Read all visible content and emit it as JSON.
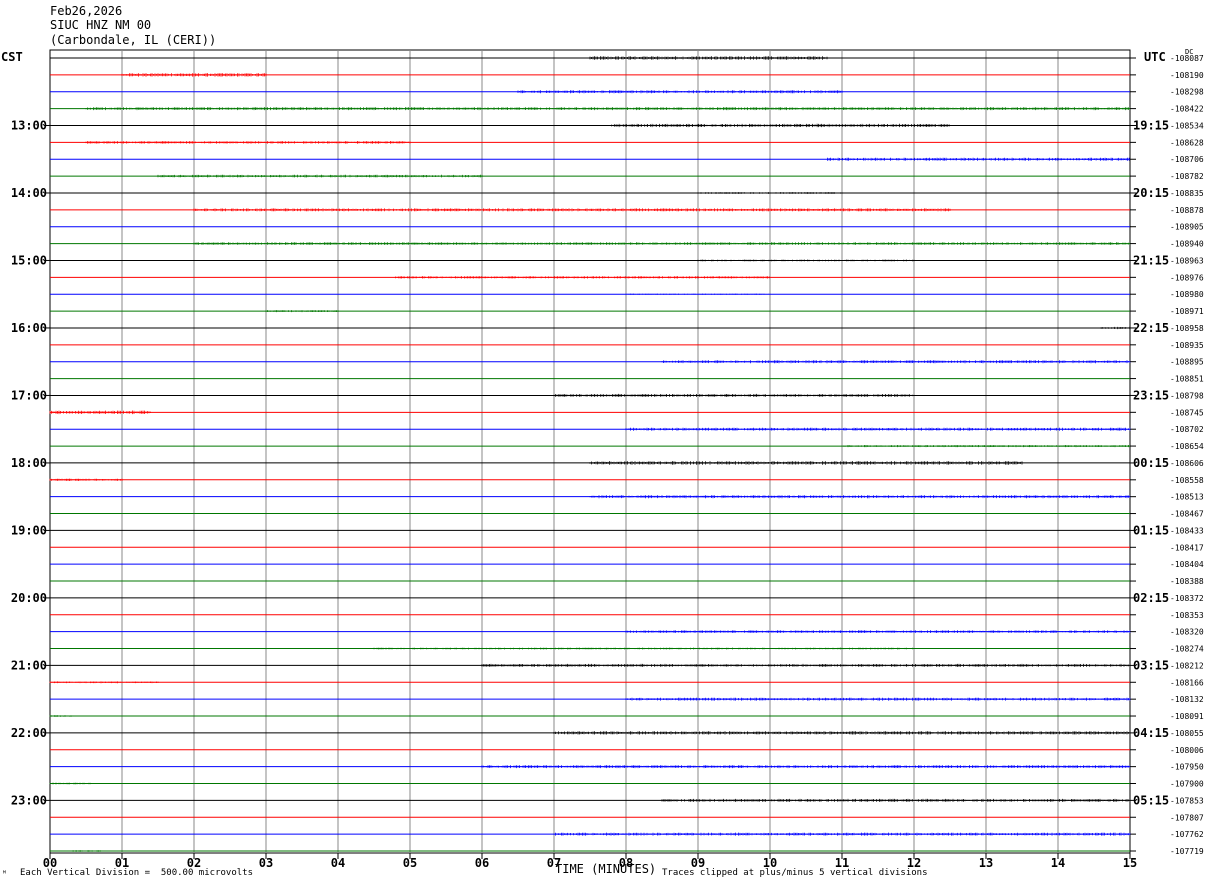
{
  "header": {
    "date": "Feb26,2026",
    "station": "SIUC HNZ NM 00",
    "location": "(Carbondale, IL (CERI))"
  },
  "labels": {
    "left_tz": "CST",
    "right_tz": "UTC",
    "dc_label": "DC",
    "xlabel": "TIME (MINUTES)",
    "scale_note": "Each Vertical Division =  500.00 microvolts",
    "clip_note": "Traces clipped at plus/minus 5 vertical divisions",
    "corner_mark": "ᴹ"
  },
  "colors": {
    "cycle": [
      "#000000",
      "#ff0000",
      "#0000ff",
      "#007700"
    ],
    "grid": "#888888"
  },
  "chart_data": {
    "type": "line",
    "title": "SIUC HNZ NM 00",
    "x_ticks": [
      "00",
      "01",
      "02",
      "03",
      "04",
      "05",
      "06",
      "07",
      "08",
      "09",
      "10",
      "11",
      "12",
      "13",
      "14",
      "15"
    ],
    "xlim": [
      0,
      15
    ],
    "hour_labels_left": [
      "13:00",
      "14:00",
      "15:00",
      "16:00",
      "17:00",
      "18:00",
      "19:00",
      "20:00",
      "21:00",
      "22:00",
      "23:00"
    ],
    "hour_labels_right": [
      "19:15",
      "20:15",
      "21:15",
      "22:15",
      "23:15",
      "00:15",
      "01:15",
      "02:15",
      "03:15",
      "04:15",
      "05:15"
    ],
    "dc_offsets": [
      "-108087",
      "-108190",
      "-108298",
      "-108422",
      "-108534",
      "-108628",
      "-108706",
      "-108782",
      "-108835",
      "-108878",
      "-108905",
      "-108940",
      "-108963",
      "-108976",
      "-108980",
      "-108971",
      "-108958",
      "-108935",
      "-108895",
      "-108851",
      "-108798",
      "-108745",
      "-108702",
      "-108654",
      "-108606",
      "-108558",
      "-108513",
      "-108467",
      "-108433",
      "-108417",
      "-108404",
      "-108388",
      "-108372",
      "-108353",
      "-108320",
      "-108274",
      "-108212",
      "-108166",
      "-108132",
      "-108091",
      "-108055",
      "-108006",
      "-107950",
      "-107900",
      "-107853",
      "-107807",
      "-107762",
      "-107719"
    ],
    "noise": [
      [
        7.5,
        10.8,
        1.2
      ],
      [
        1.0,
        3.0,
        1.2
      ],
      [
        6.5,
        11.0,
        1.0
      ],
      [
        0.5,
        15.0,
        1.0
      ],
      [
        7.8,
        12.5,
        1.1
      ],
      [
        0.5,
        5.0,
        0.9
      ],
      [
        10.8,
        15.0,
        1.0
      ],
      [
        1.5,
        6.0,
        0.9
      ],
      [
        9.0,
        11.0,
        0.6
      ],
      [
        2.0,
        12.5,
        1.0
      ],
      [
        0.0,
        0.0,
        0.3
      ],
      [
        2.0,
        15.0,
        0.9
      ],
      [
        9.0,
        12.0,
        0.6
      ],
      [
        4.8,
        10.0,
        0.8
      ],
      [
        8.0,
        10.0,
        0.4
      ],
      [
        3.0,
        4.0,
        0.7
      ],
      [
        14.6,
        15.0,
        0.8
      ],
      [
        0.0,
        0.0,
        0.3
      ],
      [
        8.5,
        15.0,
        1.0
      ],
      [
        0.0,
        0.0,
        0.3
      ],
      [
        7.0,
        12.0,
        1.0
      ],
      [
        0.0,
        1.4,
        1.2
      ],
      [
        8.0,
        15.0,
        1.0
      ],
      [
        11.0,
        15.0,
        0.7
      ],
      [
        7.5,
        13.5,
        1.2
      ],
      [
        0.0,
        1.0,
        0.8
      ],
      [
        7.5,
        15.0,
        1.0
      ],
      [
        0.0,
        0.0,
        0.3
      ],
      [
        0.0,
        0.0,
        0.3
      ],
      [
        0.0,
        0.0,
        0.3
      ],
      [
        0.0,
        0.0,
        0.3
      ],
      [
        0.3,
        0.5,
        0.5
      ],
      [
        0.0,
        0.0,
        0.3
      ],
      [
        0.0,
        0.0,
        0.3
      ],
      [
        8.0,
        15.0,
        0.9
      ],
      [
        4.5,
        12.0,
        0.6
      ],
      [
        6.0,
        15.0,
        1.0
      ],
      [
        0.0,
        1.5,
        0.6
      ],
      [
        8.0,
        15.0,
        1.0
      ],
      [
        0.0,
        0.3,
        0.6
      ],
      [
        7.0,
        15.0,
        1.1
      ],
      [
        0.0,
        0.0,
        0.3
      ],
      [
        6.0,
        15.0,
        1.0
      ],
      [
        0.0,
        0.6,
        0.6
      ],
      [
        8.5,
        15.0,
        1.0
      ],
      [
        0.0,
        0.0,
        0.3
      ],
      [
        7.0,
        15.0,
        1.0
      ],
      [
        0.3,
        0.7,
        0.6
      ]
    ]
  }
}
